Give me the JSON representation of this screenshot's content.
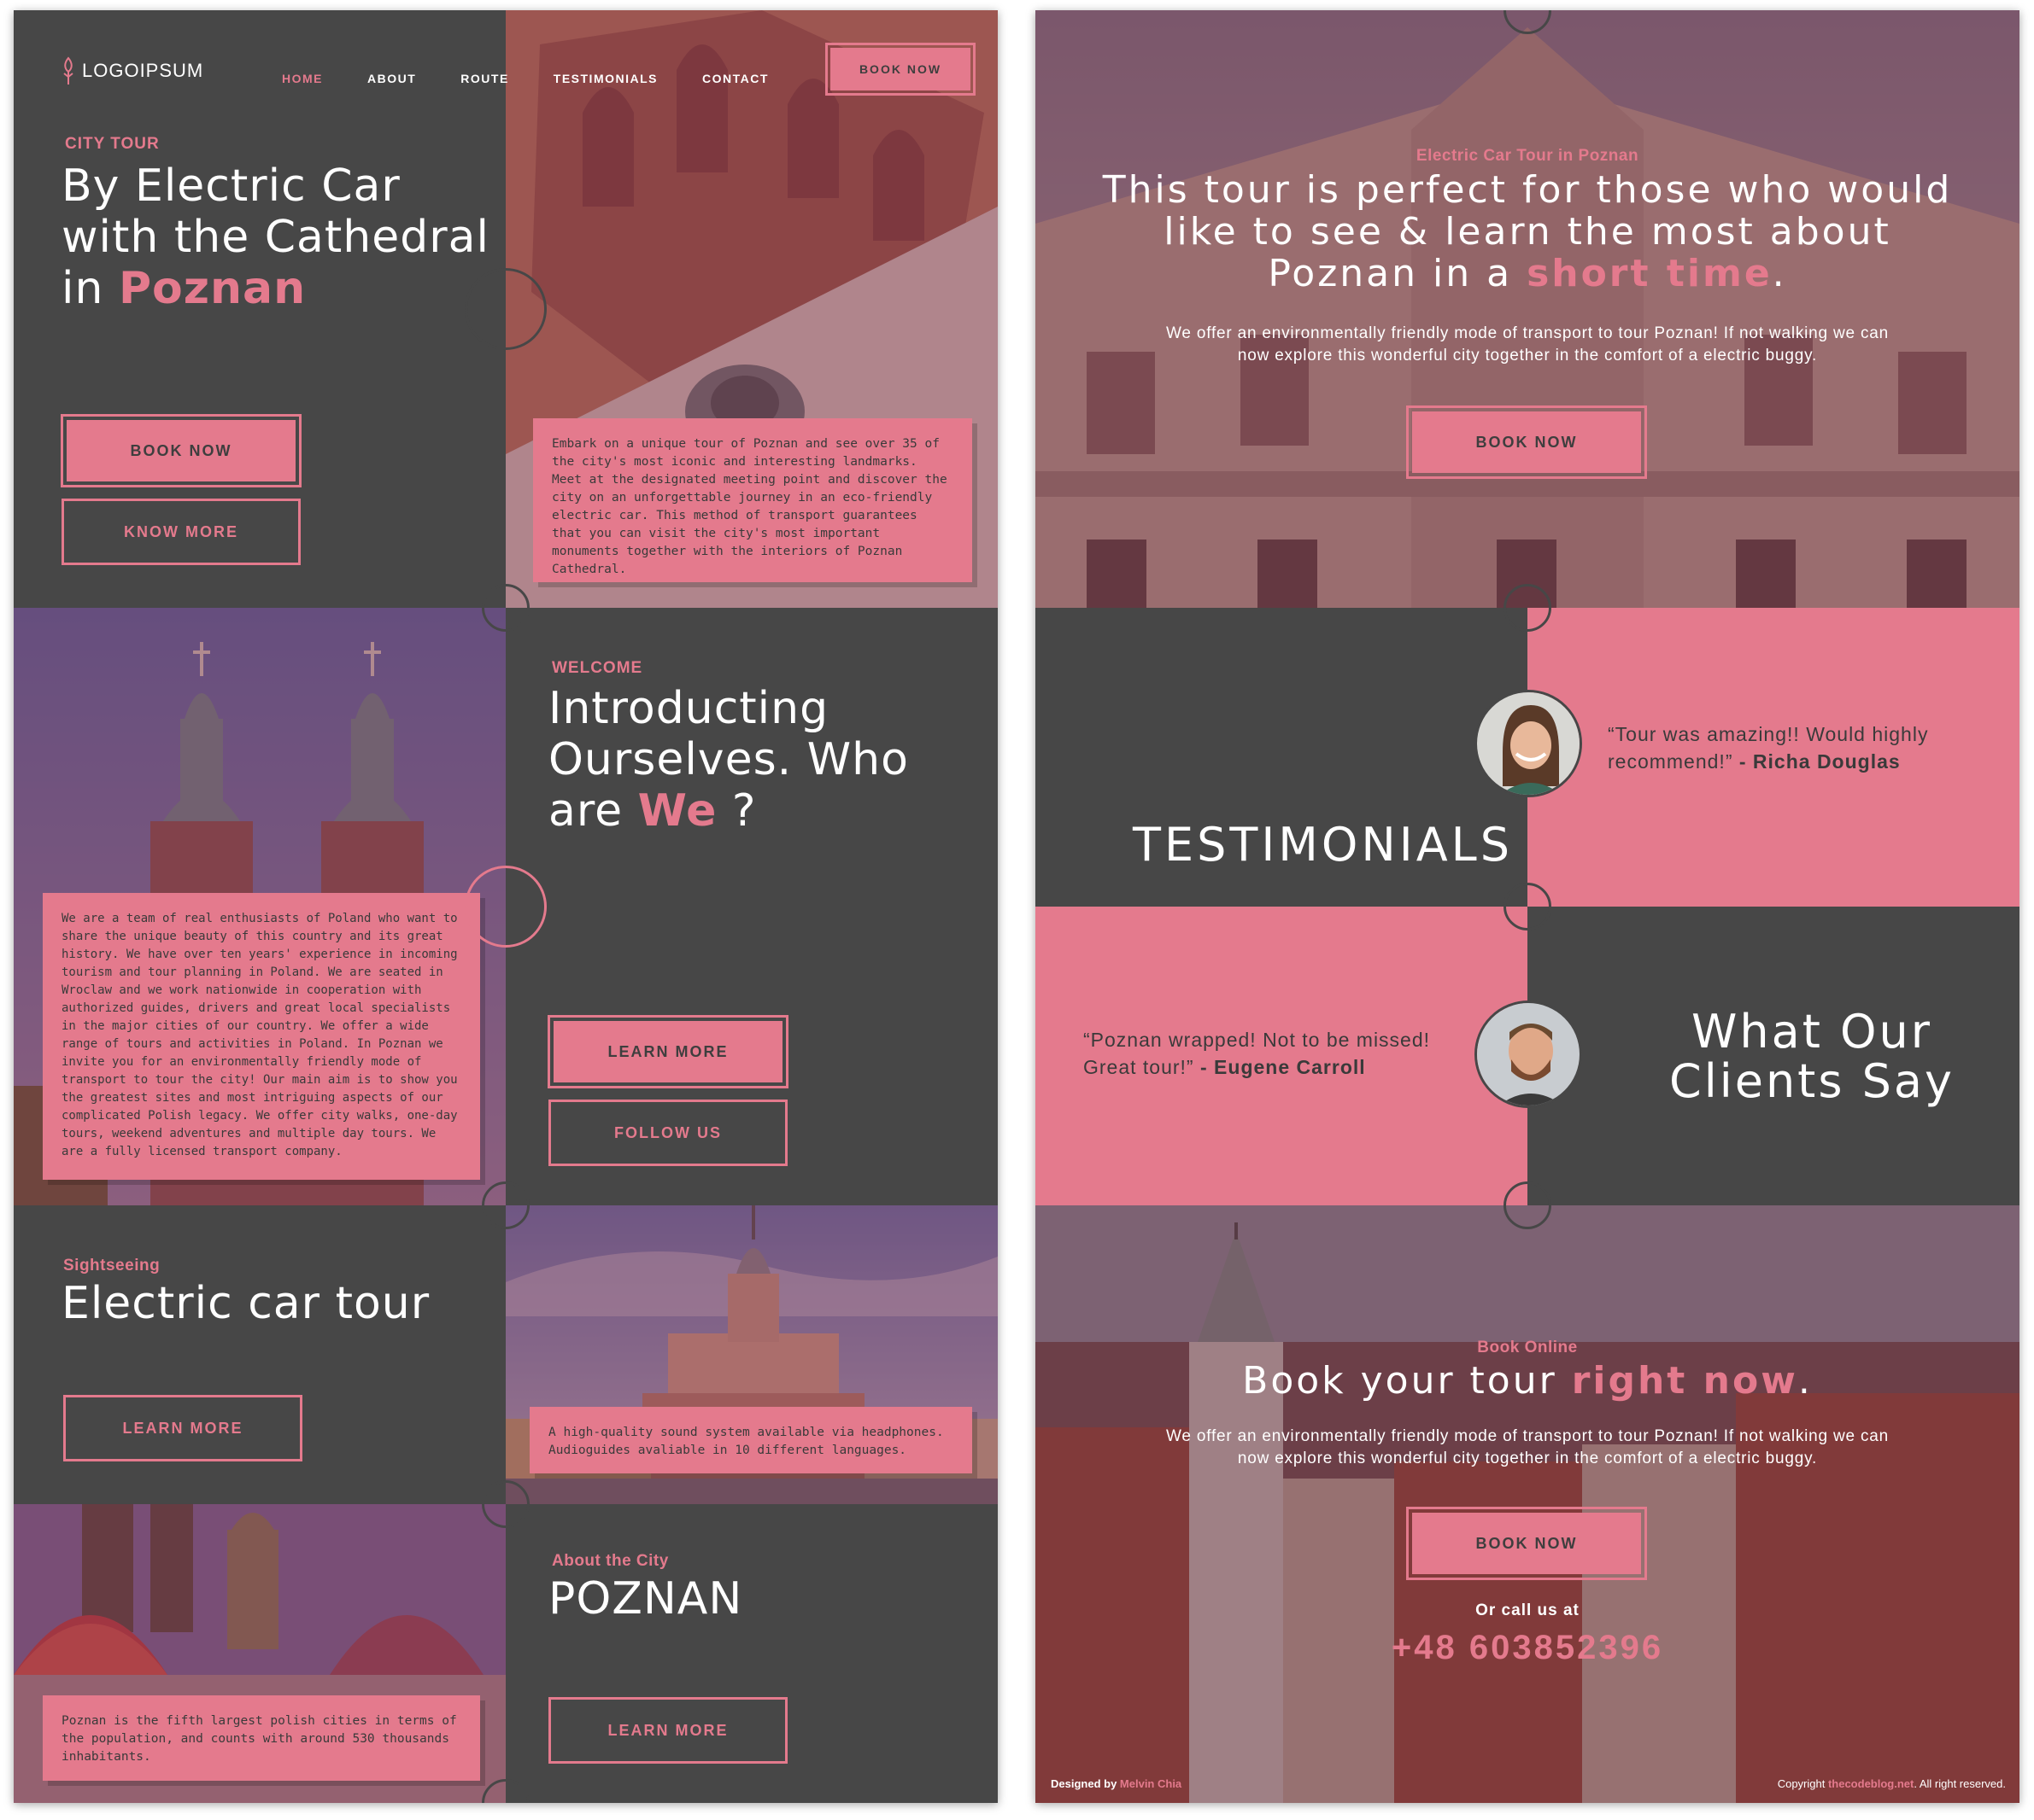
{
  "nav": {
    "logo": "LOGOIPSUM",
    "items": [
      "HOME",
      "ABOUT",
      "ROUTE",
      "TESTIMONIALS",
      "CONTACT"
    ],
    "active_index": 0,
    "book_label": "BOOK NOW"
  },
  "hero": {
    "eyebrow": "CITY TOUR",
    "title_line1": "By Electric Car",
    "title_line2": "with the Cathedral",
    "title_prefix": "in ",
    "title_accent": "Poznan",
    "book_label": "BOOK NOW",
    "know_label": "KNOW MORE",
    "card_text": "Embark on a unique tour of Poznan and see over 35 of the city's most iconic and interesting landmarks. Meet at the designated meeting point and discover the city on an unforgettable journey in an eco-friendly electric car. This method of transport guarantees that you can visit the city's most important monuments together with the interiors of Poznan Cathedral."
  },
  "welcome": {
    "eyebrow": "WELCOME",
    "title_line1": "Introducting",
    "title_line2": "Ourselves. Who",
    "title_prefix": "are ",
    "title_accent": "We",
    "title_suffix": " ?",
    "learn_label": "LEARN MORE",
    "follow_label": "FOLLOW US",
    "card_text": "We are a team of real enthusiasts of Poland who want to share the unique beauty of this country and its great history. We have over ten years' experience in incoming tourism and tour planning in Poland. We are seated in Wroclaw and we work nationwide in cooperation with authorized guides, drivers and great local specialists in the major cities of our country. We offer a wide range of tours and activities in Poland. In Poznan we invite you for an environmentally friendly mode of transport to tour the city! Our main aim is to show you the greatest sites and most intriguing aspects of our complicated Polish legacy. We offer city walks, one-day tours, weekend adventures and multiple day tours. We are a fully licensed transport company."
  },
  "sightseeing": {
    "eyebrow": "Sightseeing",
    "title": "Electric car tour",
    "learn_label": "LEARN MORE",
    "card_text": "A high-quality sound system available via headphones. Audioguides avaliable in 10 different languages."
  },
  "city": {
    "eyebrow": "About the City",
    "title": "POZNAN",
    "learn_label": "LEARN MORE",
    "card_text": "Poznan is the fifth largest polish cities in terms of the population, and counts with around 530 thousands inhabitants."
  },
  "tour": {
    "eyebrow": "Electric Car Tour in Poznan",
    "title_line1": "This tour is perfect for those who would",
    "title_line2": "like to see & learn the most about",
    "title_prefix": "Poznan in a ",
    "title_accent": "short time",
    "title_suffix": ".",
    "desc_line1": "We offer an environmentally friendly mode of transport to tour Poznan! If not walking we can",
    "desc_line2": "now explore this wonderful city together in the comfort of a electric buggy.",
    "book_label": "BOOK NOW"
  },
  "testimonials": {
    "heading": "TESTIMONIALS",
    "quote1": "“Tour was amazing!! Would highly recommend!”",
    "author1": "- Richa Douglas",
    "quote2": "“Poznan wrapped! Not to be missed! Great tour!”",
    "author2": "- Eugene Carroll",
    "clients_line1": "What Our",
    "clients_line2": "Clients Say"
  },
  "book": {
    "eyebrow": "Book Online",
    "title_prefix": "Book your tour ",
    "title_accent": "right now",
    "title_suffix": ".",
    "desc_line1": "We offer an environmentally friendly mode of transport to tour Poznan! If not walking we can",
    "desc_line2": "now explore this wonderful city together in the comfort of a electric buggy.",
    "book_label": "BOOK NOW",
    "call_label": "Or call us at",
    "phone": "+48 603852396"
  },
  "footer": {
    "designed_prefix": "Designed by ",
    "designer": "Melvin Chia",
    "copyright_prefix": "Copyright ",
    "copyright_site": "thecodeblog.net",
    "copyright_suffix": ". All right reserved."
  },
  "colors": {
    "accent": "#e47a8d",
    "dark": "#474747",
    "overlay": "#7a2846"
  }
}
